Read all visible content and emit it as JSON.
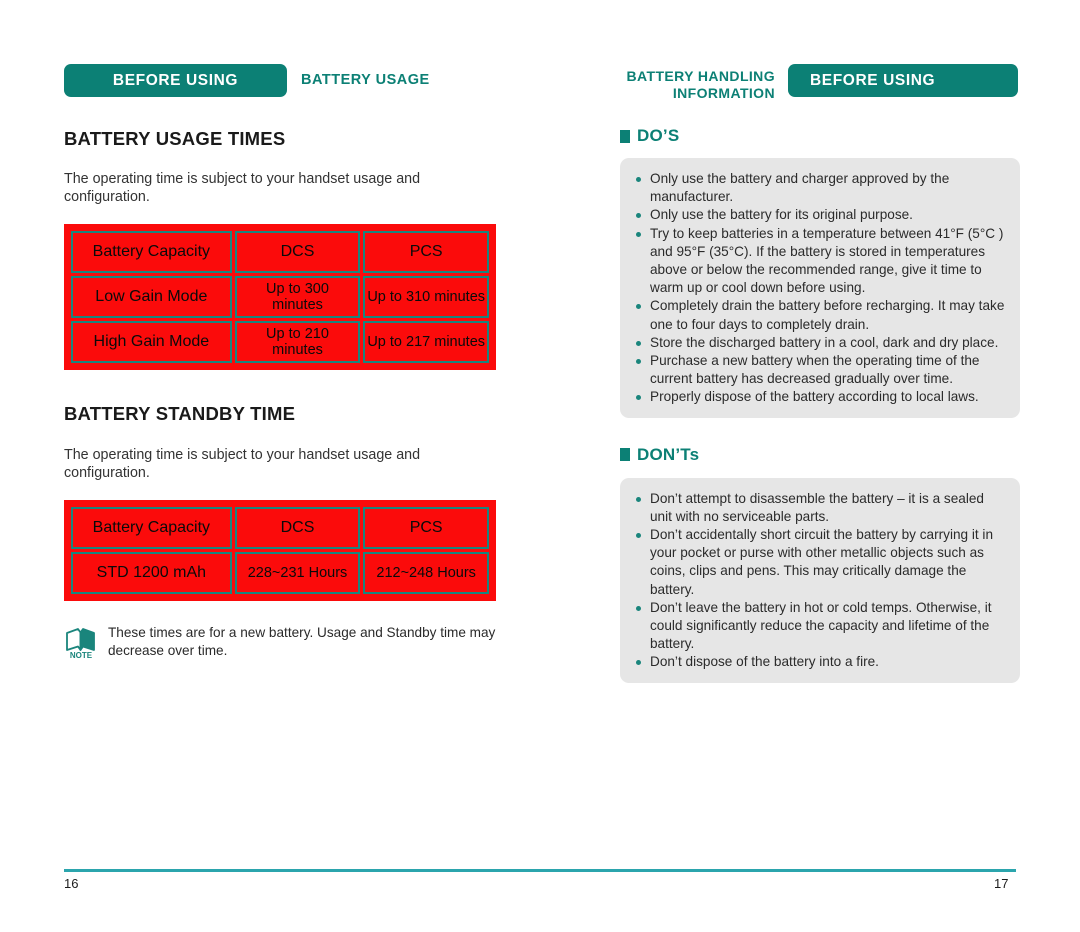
{
  "colors": {
    "teal": "#0c8075",
    "teal_rule": "#2ba5ad",
    "table_red": "#fb0b0b",
    "table_border": "#19867f",
    "panel_gray": "#e6e6e6"
  },
  "left_page": {
    "tab_label": "BEFORE USING",
    "chapter_label": "BATTERY USAGE",
    "page_number": "16",
    "section1": {
      "heading": "BATTERY USAGE TIMES",
      "lead": "The operating time is subject to your handset usage and configuration.",
      "table": {
        "headers": [
          "Battery Capacity",
          "DCS",
          "PCS"
        ],
        "rows": [
          [
            "Low Gain Mode",
            "Up to 300 minutes",
            "Up to 310 minutes"
          ],
          [
            "High Gain Mode",
            "Up to 210 minutes",
            "Up to 217 minutes"
          ]
        ]
      }
    },
    "section2": {
      "heading": "BATTERY STANDBY TIME",
      "lead": "The operating time is subject to your handset usage and configuration.",
      "table": {
        "headers": [
          "Battery Capacity",
          "DCS",
          "PCS"
        ],
        "rows": [
          [
            "STD 1200 mAh",
            "228~231 Hours",
            "212~248 Hours"
          ]
        ]
      }
    },
    "note": {
      "icon_label": "NOTE",
      "text": "These times are for a new battery. Usage and Standby time may decrease over time."
    }
  },
  "right_page": {
    "tab_label": "BEFORE USING",
    "chapter_label": "BATTERY HANDLING INFORMATION",
    "page_number": "17",
    "dos": {
      "heading": "DO’S",
      "items": [
        "Only use the battery and charger approved by the manufacturer.",
        "Only use the battery for its original purpose.",
        "Try to keep batteries in a temperature between 41°F (5°C ) and 95°F (35°C). If the battery is stored in temperatures above or below the recommended range, give it time to warm up or cool down before using.",
        "Completely drain the battery before recharging. It may take one to four days to completely drain.",
        "Store the discharged battery in a cool, dark and dry place.",
        "Purchase a new battery when the operating time of the current battery has decreased gradually over time.",
        "Properly dispose of the battery according to local laws."
      ]
    },
    "donts": {
      "heading": "DON’Ts",
      "items": [
        "Don’t attempt to disassemble the battery – it is a sealed unit with no serviceable parts.",
        "Don’t accidentally short circuit the battery by carrying it in your pocket or purse with other metallic objects such as coins, clips and pens. This may critically damage the battery.",
        "Don’t leave the battery in hot or cold temps. Otherwise, it could significantly reduce the capacity and lifetime of the battery.",
        "Don’t dispose of the battery into a fire."
      ]
    }
  }
}
